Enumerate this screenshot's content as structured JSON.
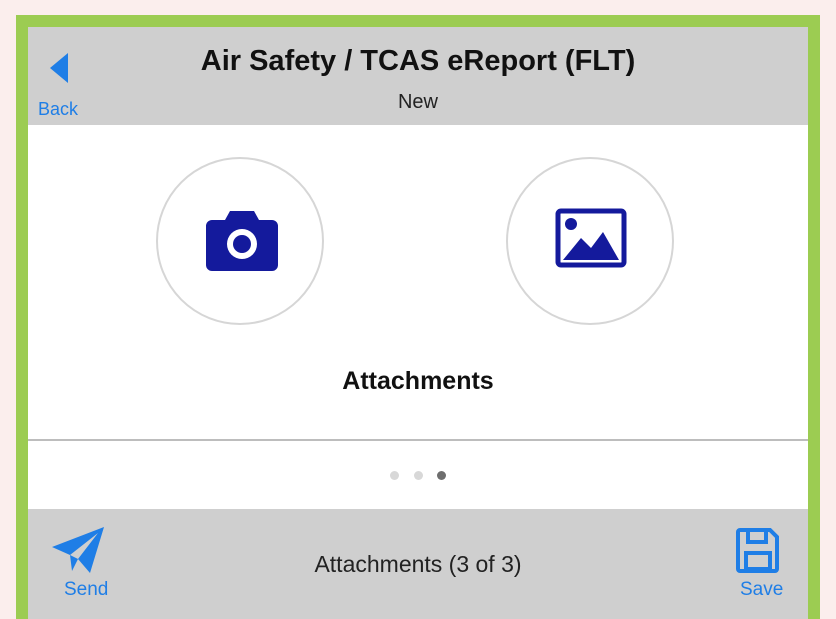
{
  "header": {
    "back_label": "Back",
    "title": "Air Safety / TCAS eReport (FLT)",
    "subtitle": "New"
  },
  "main": {
    "camera_icon": "camera-icon",
    "gallery_icon": "image-gallery-icon",
    "section_label": "Attachments"
  },
  "pager": {
    "current_page": 3,
    "total_pages": 3
  },
  "footer": {
    "send_label": "Send",
    "status": "Attachments (3 of 3)",
    "save_label": "Save"
  },
  "colors": {
    "accent": "#1f7ee6",
    "icon_navy": "#141a9c",
    "frame_border": "#9ccc52",
    "bar_gray": "#cfcfcf"
  }
}
